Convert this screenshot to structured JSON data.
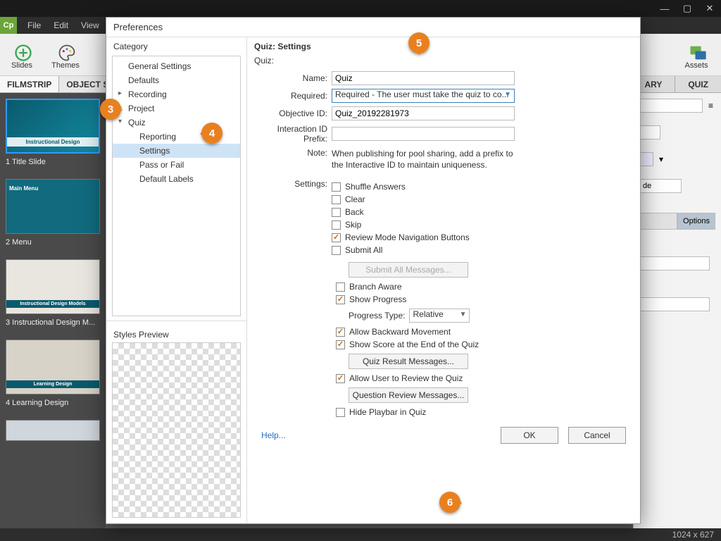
{
  "menubar": {
    "items": [
      "File",
      "Edit",
      "View"
    ]
  },
  "toolbar": {
    "slides_label": "Slides",
    "themes_label": "Themes",
    "assets_label": "Assets"
  },
  "left_tabs": {
    "filmstrip": "FILMSTRIP",
    "object_states": "OBJECT STA"
  },
  "right_tabs": {
    "library": "ARY",
    "quiz": "QUIZ"
  },
  "filmstrip": {
    "items": [
      {
        "caption": "1 Title Slide",
        "title": "Instructional Design"
      },
      {
        "caption": "2 Menu",
        "title": "Main Menu"
      },
      {
        "caption": "3 Instructional Design M...",
        "title": "Instructional Design Models"
      },
      {
        "caption": "4 Learning Design",
        "title": "Learning Design"
      }
    ]
  },
  "props": {
    "style_tab": "de",
    "options_tab": "Options"
  },
  "status": {
    "dimensions": "1024 x 627"
  },
  "dialog": {
    "title": "Preferences",
    "category_header": "Category",
    "tree": {
      "general": "General Settings",
      "defaults": "Defaults",
      "recording": "Recording",
      "project": "Project",
      "quiz": "Quiz",
      "quiz_children": [
        "Reporting",
        "Settings",
        "Pass or Fail",
        "Default Labels"
      ]
    },
    "styles_preview_label": "Styles Preview",
    "panel_header": "Quiz: Settings",
    "quiz_label": "Quiz:",
    "name_label": "Name:",
    "name_value": "Quiz",
    "required_label": "Required:",
    "required_value": "Required - The user must take the quiz to  co...",
    "objective_label": "Objective ID:",
    "objective_value": "Quiz_20192281973",
    "prefix_label": "Interaction ID Prefix:",
    "prefix_value": "",
    "note_label": "Note:",
    "note_text": "When publishing for pool sharing, add a prefix to the Interactive ID to maintain uniqueness.",
    "settings_label": "Settings:",
    "checks": {
      "shuffle": "Shuffle Answers",
      "clear": "Clear",
      "back": "Back",
      "skip": "Skip",
      "review_nav": "Review Mode Navigation Buttons",
      "submit_all": "Submit All",
      "branch_aware": "Branch Aware",
      "show_progress": "Show Progress",
      "allow_back": "Allow Backward Movement",
      "show_score": "Show Score at the End of the Quiz",
      "allow_review": "Allow User to Review the Quiz",
      "hide_playbar": "Hide Playbar in Quiz"
    },
    "buttons": {
      "submit_all_msgs": "Submit All Messages...",
      "quiz_result_msgs": "Quiz Result Messages...",
      "question_review_msgs": "Question Review Messages..."
    },
    "progress_type_label": "Progress Type:",
    "progress_type_value": "Relative",
    "help": "Help...",
    "ok": "OK",
    "cancel": "Cancel"
  },
  "badges": {
    "b3": "3",
    "b4": "4",
    "b5": "5",
    "b6": "6"
  }
}
